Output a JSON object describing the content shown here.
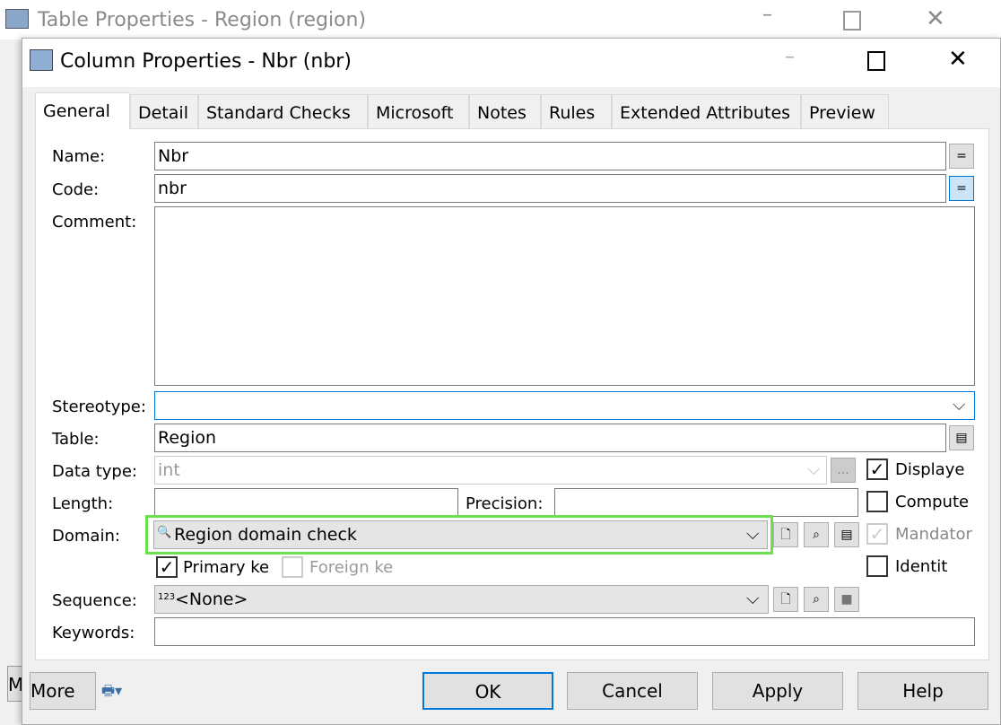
{
  "background_window": {
    "title": "Table Properties - Region (region)"
  },
  "dialog": {
    "title": "Column Properties - Nbr (nbr)"
  },
  "tabs": [
    "General",
    "Detail",
    "Standard Checks",
    "Microsoft",
    "Notes",
    "Rules",
    "Extended Attributes",
    "Preview"
  ],
  "form": {
    "name_label": "Name:",
    "name_value": "Nbr",
    "code_label": "Code:",
    "code_value": "nbr",
    "comment_label": "Comment:",
    "comment_value": "",
    "stereotype_label": "Stereotype:",
    "stereotype_value": "",
    "table_label": "Table:",
    "table_value": "Region",
    "datatype_label": "Data type:",
    "datatype_value": "int",
    "length_label": "Length:",
    "length_value": "",
    "precision_label": "Precision:",
    "precision_value": "",
    "domain_label": "Domain:",
    "domain_value": "Region domain check",
    "primary_key_label": "Primary ke",
    "primary_key_checked": true,
    "foreign_key_label": "Foreign ke",
    "foreign_key_checked": false,
    "sequence_label": "Sequence:",
    "sequence_value": "<None>",
    "keywords_label": "Keywords:",
    "keywords_value": "",
    "displayed_label": "Displaye",
    "displayed_checked": true,
    "computed_label": "Compute",
    "computed_checked": false,
    "mandatory_label": "Mandator",
    "mandatory_checked": true,
    "identity_label": "Identit",
    "identity_checked": false,
    "equals": "=",
    "ellipsis": "..."
  },
  "buttons": {
    "more": "More >>",
    "ok": "OK",
    "cancel": "Cancel",
    "apply": "Apply",
    "help": "Help"
  },
  "colors": {
    "highlight": "#6de04f",
    "accent": "#0078d7"
  }
}
